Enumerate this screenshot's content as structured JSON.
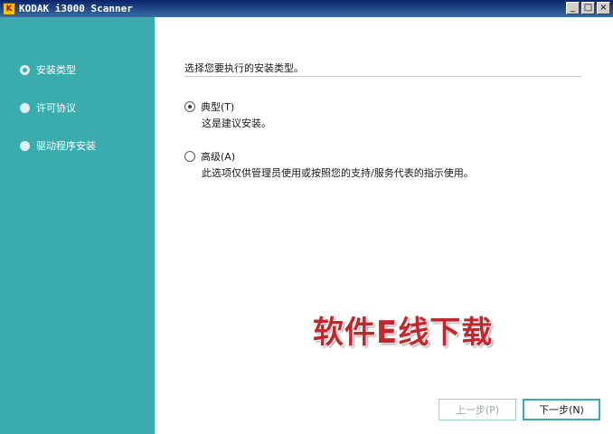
{
  "window": {
    "title": "KODAK i3000 Scanner",
    "icon_glyph": "K",
    "minimize_glyph": "_",
    "maximize_glyph": "□",
    "close_glyph": "×"
  },
  "sidebar": {
    "steps": [
      {
        "label": "安装类型",
        "active": true
      },
      {
        "label": "许可协议",
        "active": false
      },
      {
        "label": "驱动程序安装",
        "active": false
      }
    ]
  },
  "main": {
    "heading": "选择您要执行的安装类型。",
    "options": [
      {
        "label": "典型(T)",
        "description": "这是建议安装。",
        "selected": true
      },
      {
        "label": "高级(A)",
        "description": "此选项仅供管理员使用或按照您的支持/服务代表的指示使用。",
        "selected": false
      }
    ]
  },
  "watermark": "软件E线下载",
  "buttons": {
    "back": "上一步(P)",
    "next": "下一步(N)"
  },
  "colors": {
    "sidebar": "#3aacad",
    "titlebar": "#0a246a",
    "watermark": "#c0282d"
  }
}
